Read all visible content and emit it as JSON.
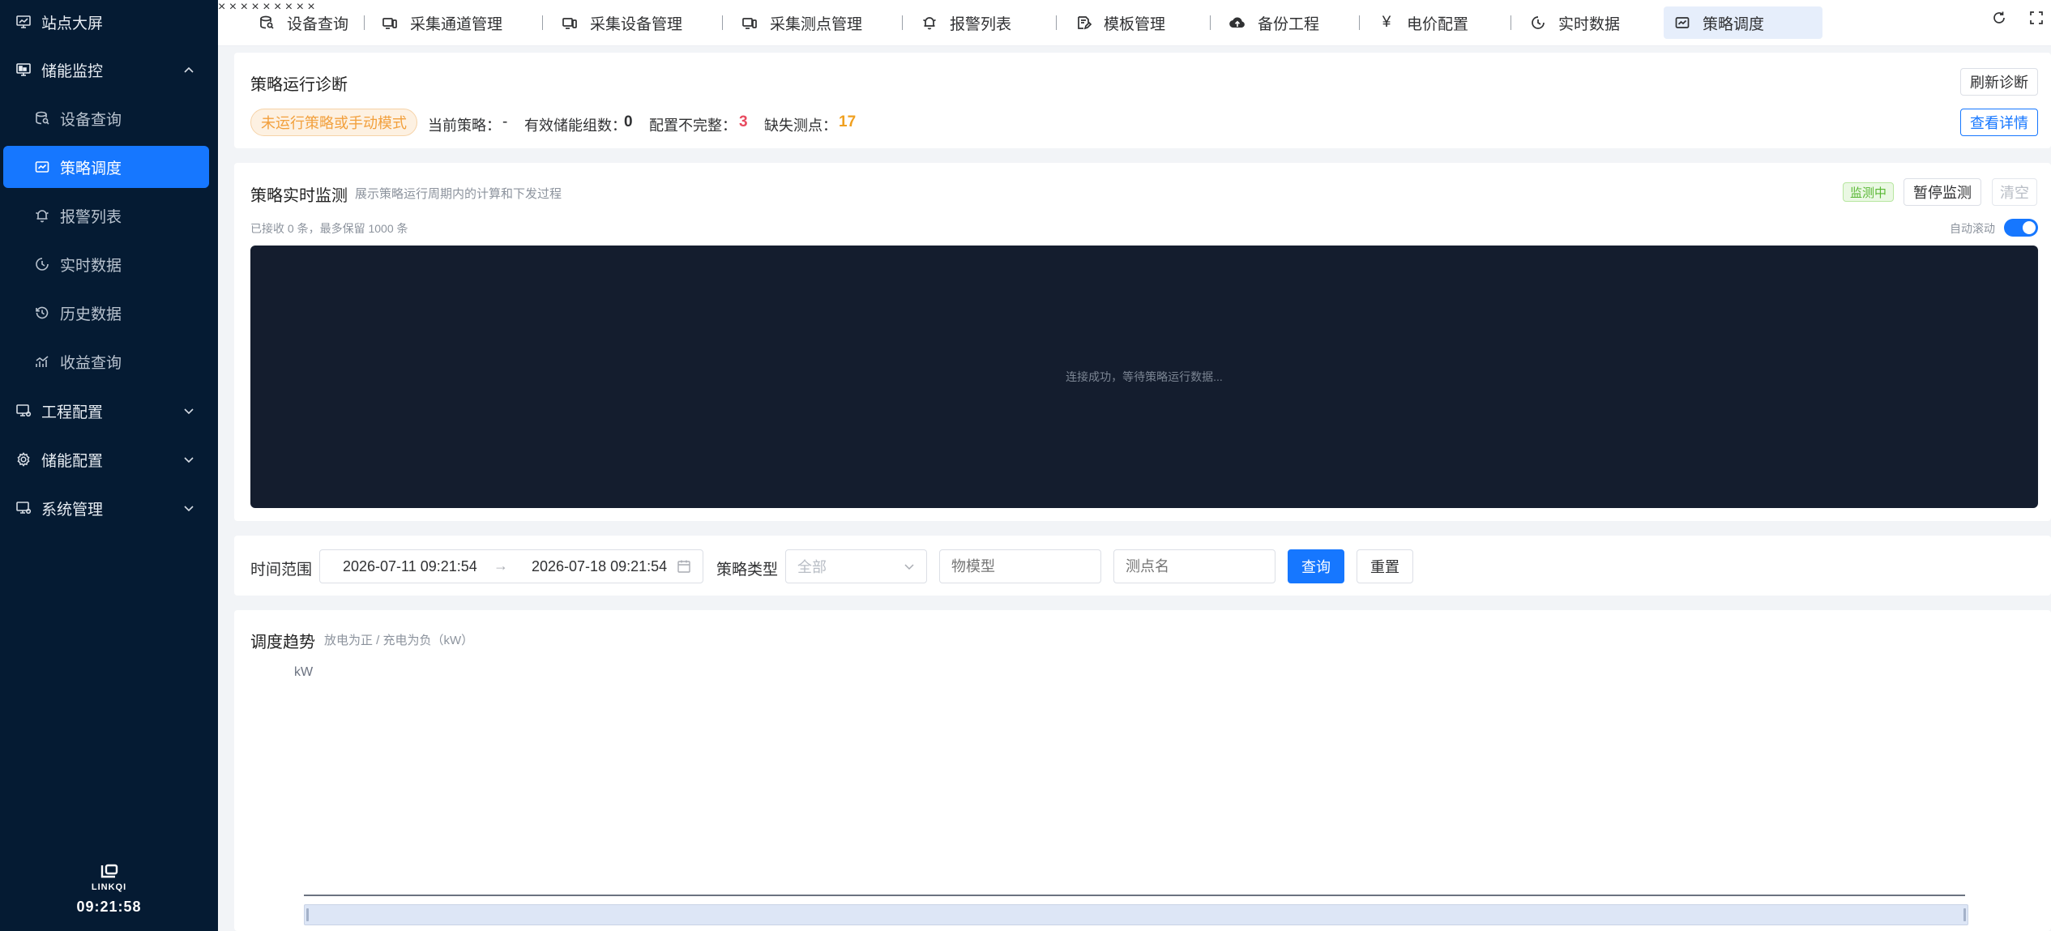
{
  "sidebar": {
    "items": [
      {
        "label": "站点大屏",
        "icon": "monitor-icon",
        "level": "top"
      },
      {
        "label": "储能监控",
        "icon": "monitor-chart-icon",
        "level": "top",
        "expanded": true
      },
      {
        "label": "设备查询",
        "icon": "database-search-icon",
        "level": "sub"
      },
      {
        "label": "策略调度",
        "icon": "strategy-icon",
        "level": "sub",
        "active": true
      },
      {
        "label": "报警列表",
        "icon": "bell-icon",
        "level": "sub"
      },
      {
        "label": "实时数据",
        "icon": "clock-icon",
        "level": "sub"
      },
      {
        "label": "历史数据",
        "icon": "history-icon",
        "level": "sub"
      },
      {
        "label": "收益查询",
        "icon": "trend-icon",
        "level": "sub"
      },
      {
        "label": "工程配置",
        "icon": "project-monitor-icon",
        "level": "top",
        "expanded": false
      },
      {
        "label": "储能配置",
        "icon": "gear-icon",
        "level": "top",
        "expanded": false
      },
      {
        "label": "系统管理",
        "icon": "system-monitor-icon",
        "level": "top",
        "expanded": false
      }
    ],
    "brand": "LINKQI",
    "clock": "09:21:58"
  },
  "tabs": [
    {
      "label": "设备查询",
      "icon": "database-search-icon",
      "closable": false
    },
    {
      "label": "采集通道管理",
      "icon": "device-icon",
      "closable": true
    },
    {
      "label": "采集设备管理",
      "icon": "device-icon",
      "closable": true
    },
    {
      "label": "采集测点管理",
      "icon": "device-icon",
      "closable": true
    },
    {
      "label": "报警列表",
      "icon": "bell-icon",
      "closable": true
    },
    {
      "label": "模板管理",
      "icon": "edit-doc-icon",
      "closable": true
    },
    {
      "label": "备份工程",
      "icon": "cloud-upload-icon",
      "closable": true
    },
    {
      "label": "电价配置",
      "icon": "yen-icon",
      "closable": true
    },
    {
      "label": "实时数据",
      "icon": "clock-icon",
      "closable": true
    },
    {
      "label": "策略调度",
      "icon": "strategy-icon",
      "closable": true,
      "active": true
    }
  ],
  "diagnosis": {
    "title": "策略运行诊断",
    "refresh_label": "刷新诊断",
    "status_tag": "未运行策略或手动模式",
    "current_strategy_label": "当前策略：",
    "current_strategy_value": "-",
    "valid_groups_label": "有效储能组数：",
    "valid_groups_value": "0",
    "incomplete_label": "配置不完整：",
    "incomplete_value": "3",
    "missing_label": "缺失测点：",
    "missing_value": "17",
    "detail_label": "查看详情",
    "colors": {
      "incomplete": "#e84a5f",
      "missing": "#f0a020"
    }
  },
  "monitor": {
    "title": "策略实时监测",
    "subtitle": "展示策略运行周期内的计算和下发过程",
    "status_tag": "监测中",
    "pause_label": "暂停监测",
    "clear_label": "清空",
    "received_text": "已接收 0 条，最多保留 1000 条",
    "auto_scroll_label": "自动滚动",
    "auto_scroll_on": true,
    "console_message": "连接成功，等待策略运行数据..."
  },
  "filters": {
    "time_range_label": "时间范围",
    "start": "2026-07-11 09:21:54",
    "end": "2026-07-18 09:21:54",
    "strategy_type_label": "策略类型",
    "strategy_type_value": "全部",
    "model_placeholder": "物模型",
    "point_placeholder": "测点名",
    "query_label": "查询",
    "reset_label": "重置"
  },
  "trend": {
    "title": "调度趋势",
    "subtitle": "放电为正 / 充电为负（kW）",
    "y_unit": "kW"
  },
  "colors": {
    "sidebar_bg": "#051b33",
    "primary": "#1677ff",
    "console_bg": "#141d2e",
    "warn": "#f2a03d",
    "success": "#58b733"
  }
}
